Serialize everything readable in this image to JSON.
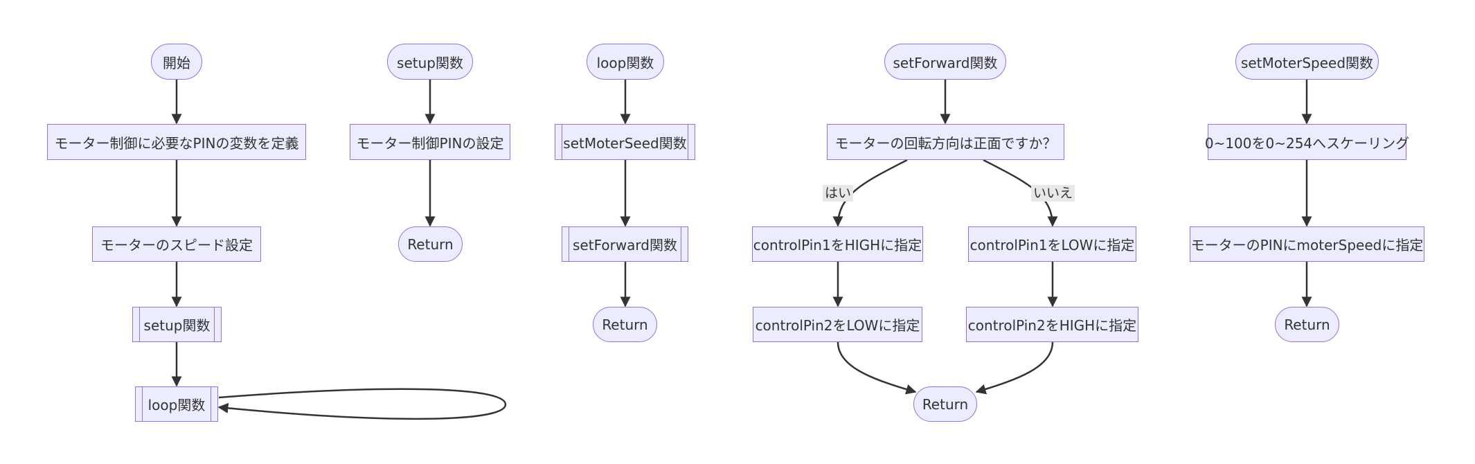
{
  "flow_main": {
    "start": "開始",
    "define_pins": "モーター制御に必要なPINの変数を定義",
    "speed_setting": "モーターのスピード設定",
    "setup_call": "setup関数",
    "loop_call": "loop関数"
  },
  "flow_setup": {
    "title": "setup関数",
    "pin_setting": "モーター制御PINの設定",
    "return": "Return"
  },
  "flow_loop": {
    "title": "loop関数",
    "speed_call": "setMoterSeed関数",
    "forward_call": "setForward関数",
    "return": "Return"
  },
  "flow_set_forward": {
    "title": "setForward関数",
    "decision": "モーターの回転方向は正面ですか？",
    "yes_label": "はい",
    "no_label": "いいえ",
    "yes_step1": "controlPin1をHIGHに指定",
    "yes_step2": "controlPin2をLOWに指定",
    "no_step1": "controlPin1をLOWに指定",
    "no_step2": "controlPin2をHIGHに指定",
    "return": "Return"
  },
  "flow_set_speed": {
    "title": "setMoterSpeed関数",
    "scaling": "0~100を0~254へスケーリング",
    "assign": "モーターのPINにmoterSpeedに指定",
    "return": "Return"
  },
  "colors": {
    "node_fill": "#ececff",
    "node_border": "#9370db",
    "edge": "#333333",
    "edge_label_bg": "#e8e8e8"
  }
}
